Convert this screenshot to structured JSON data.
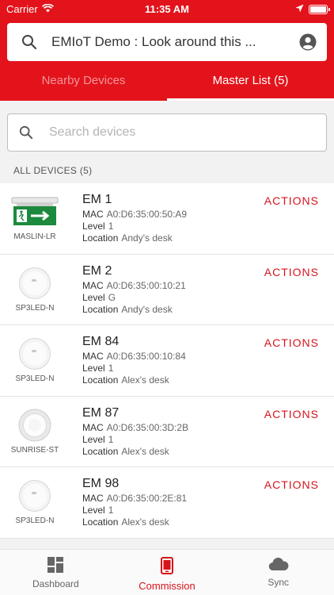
{
  "status": {
    "carrier": "Carrier",
    "time": "11:35 AM"
  },
  "header": {
    "search_text": "EMIoT Demo : Look around this ...",
    "tabs": [
      {
        "label": "Nearby Devices",
        "active": false
      },
      {
        "label": "Master List (5)",
        "active": true
      }
    ]
  },
  "search": {
    "placeholder": "Search devices"
  },
  "section_label": "ALL DEVICES (5)",
  "labels": {
    "mac": "MAC",
    "level": "Level",
    "location": "Location",
    "actions": "ACTIONS"
  },
  "devices": [
    {
      "name": "EM 1",
      "model": "MASLIN-LR",
      "icon": "exit-sign-icon",
      "mac": "A0:D6:35:00:50:A9",
      "level": "1",
      "location": "Andy's desk"
    },
    {
      "name": "EM 2",
      "model": "SP3LED-N",
      "icon": "round-downlight-icon",
      "mac": "A0:D6:35:00:10:21",
      "level": "G",
      "location": "Andy's desk"
    },
    {
      "name": "EM 84",
      "model": "SP3LED-N",
      "icon": "round-downlight-icon",
      "mac": "A0:D6:35:00:10:84",
      "level": "1",
      "location": "Alex's desk"
    },
    {
      "name": "EM 87",
      "model": "SUNRISE-ST",
      "icon": "ceiling-light-icon",
      "mac": "A0:D6:35:00:3D:2B",
      "level": "1",
      "location": "Alex's desk"
    },
    {
      "name": "EM 98",
      "model": "SP3LED-N",
      "icon": "round-downlight-icon",
      "mac": "A0:D6:35:00:2E:81",
      "level": "1",
      "location": "Alex's desk"
    }
  ],
  "nav": [
    {
      "label": "Dashboard",
      "icon": "dashboard-icon",
      "active": false
    },
    {
      "label": "Commission",
      "icon": "phone-icon",
      "active": true
    },
    {
      "label": "Sync",
      "icon": "cloud-icon",
      "active": false
    }
  ],
  "colors": {
    "brand_red": "#e3131b",
    "action_red": "#d7141c"
  }
}
